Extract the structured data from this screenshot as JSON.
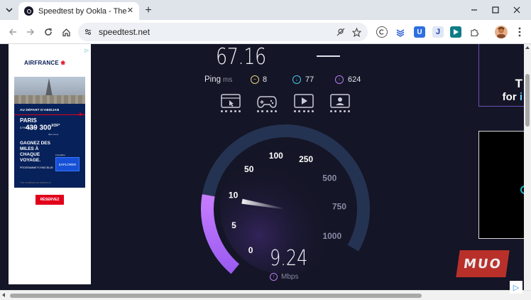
{
  "browser": {
    "tab_title": "Speedtest by Ookla - The Global Broadband Speed Test",
    "url": "speedtest.net"
  },
  "ad_left": {
    "brand": "AIRFRANCE",
    "brand_mark": "❀",
    "depart": "AU DÉPART D'ABIDJAN",
    "city": "PARIS",
    "from_label": "À PARTIR DE",
    "price": "439 300",
    "currency": "XOF*",
    "fare_type": "aller-retour",
    "headline": "GAGNEZ DES MILES À CHAQUE VOYAGE.",
    "program": "PROGRAMME FLYING BLUE",
    "program_tag": "FlyingBlue",
    "explore": "EXPLORER",
    "disclaimer": "*Voir conditions sur airfrance.ci",
    "cta": "RÉSERVEZ"
  },
  "speedtest": {
    "top_reading": "67.16",
    "ping_label": "Ping",
    "ping_unit": "ms",
    "jitter_value": "8",
    "download_ping": "77",
    "upload_ping": "624",
    "reading": "9.24",
    "unit": "Mbps",
    "mode_icons": [
      "browsing-icon",
      "gaming-icon",
      "video-streaming-icon",
      "video-chat-icon"
    ],
    "gauge": {
      "scale_labels": [
        "0",
        "5",
        "10",
        "50",
        "100",
        "250",
        "500",
        "750",
        "1000"
      ],
      "current_value": 9.24,
      "arc_color": "#253352",
      "fill_color_start": "#9b5cf0",
      "fill_color_end": "#c77dff"
    }
  },
  "right_ad": {
    "line1": "T",
    "line2_prefix": "for ",
    "line2_accent": "i"
  },
  "watermark": "MUO",
  "colors": {
    "page_bg": "#141526",
    "jitter": "#e8d27a",
    "download": "#46c6e8",
    "upload": "#b87cf4"
  }
}
